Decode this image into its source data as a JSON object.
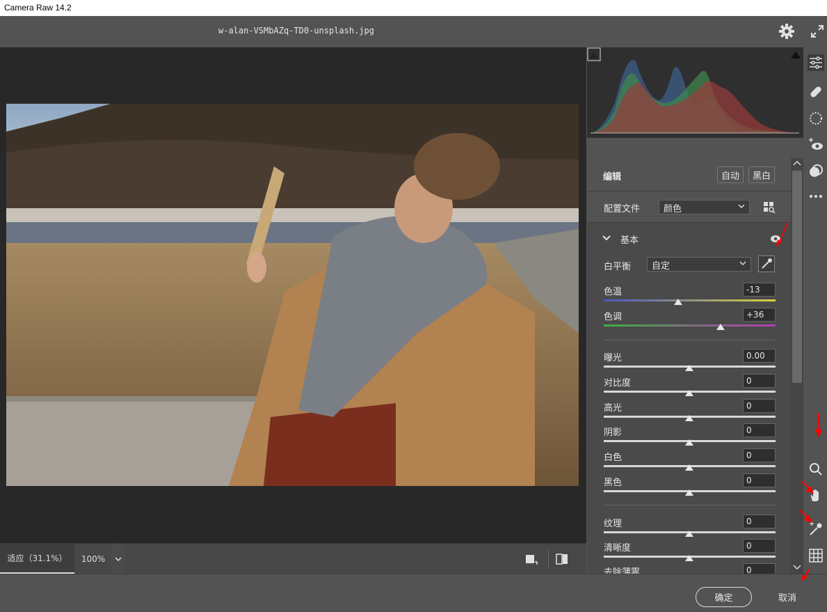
{
  "window": {
    "title": "Camera Raw 14.2"
  },
  "header": {
    "filename": "w-alan-VSMbAZq-TD0-unsplash.jpg"
  },
  "zoom": {
    "fit_label": "适应（31.1%）",
    "zoom_value": "100%"
  },
  "footer": {
    "ok_label": "确定",
    "cancel_label": "取消"
  },
  "edit": {
    "title": "编辑",
    "auto_label": "自动",
    "bw_label": "黑白"
  },
  "profile": {
    "label": "配置文件",
    "value": "颜色"
  },
  "basic": {
    "title": "基本",
    "wb_label": "白平衡",
    "wb_value": "自定",
    "temp_label": "色温",
    "temp_value": "-13",
    "temp_level": -13,
    "tint_label": "色调",
    "tint_value": "+36",
    "tint_level": 36,
    "exposure_label": "曝光",
    "exposure_value": "0.00",
    "contrast_label": "对比度",
    "contrast_value": "0",
    "highlights_label": "高光",
    "highlights_value": "0",
    "shadows_label": "阴影",
    "shadows_value": "0",
    "whites_label": "白色",
    "whites_value": "0",
    "blacks_label": "黑色",
    "blacks_value": "0",
    "texture_label": "纹理",
    "texture_value": "0",
    "clarity_label": "清晰度",
    "clarity_value": "0",
    "dehaze_label": "去除薄雾",
    "dehaze_value": "0"
  },
  "colors": {
    "accent_arrow": "#ff0000",
    "panel_bg": "#4a4a4a",
    "canvas_bg": "#282828"
  }
}
